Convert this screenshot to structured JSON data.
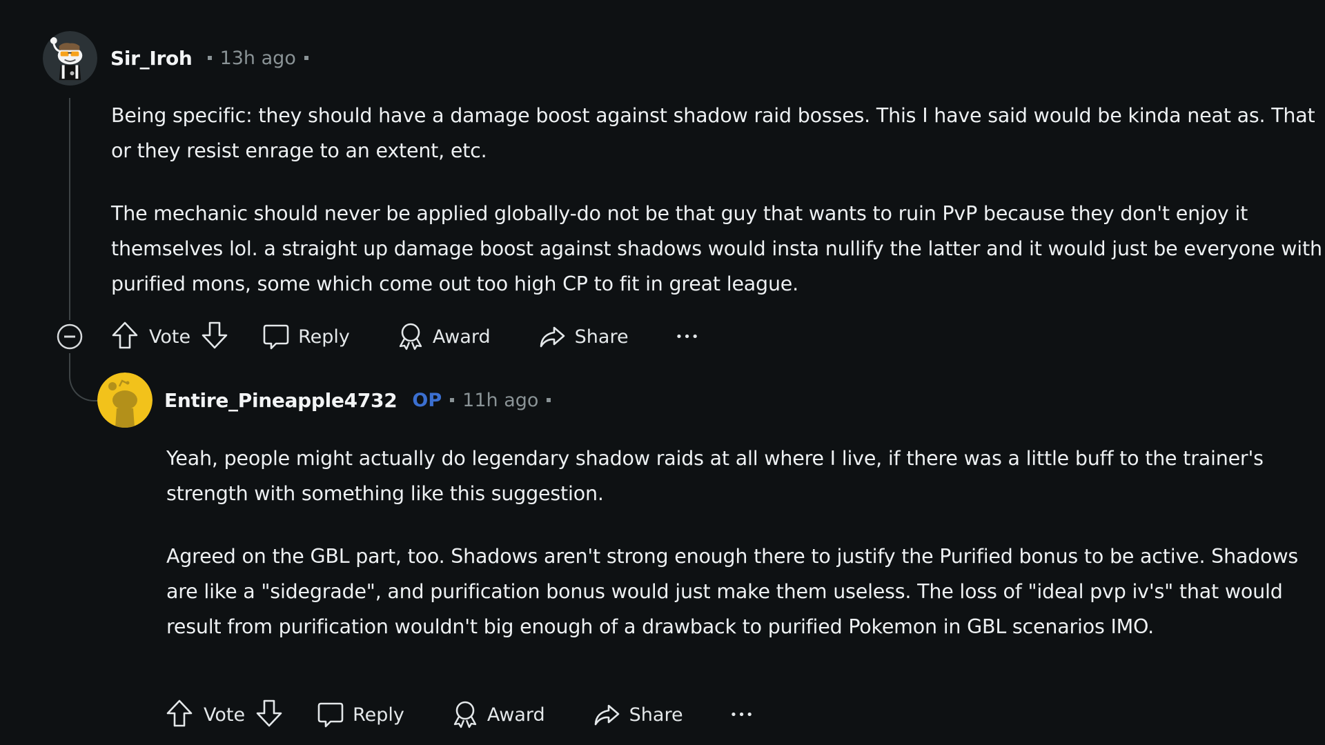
{
  "colors": {
    "background": "#0e1113",
    "text": "#eef1f3",
    "meta": "#8a9396",
    "op_badge": "#3b6fd0",
    "thread_line": "#3e4446",
    "reply_avatar": "#f2c21b"
  },
  "comments": [
    {
      "author": "Sir_Iroh",
      "avatar_icon": "snoo-avatar-sunglasses",
      "timestamp": "13h ago",
      "paragraphs": [
        "Being specific: they should have a damage boost against shadow raid bosses. This I have said would be kinda neat as. That or they resist enrage to an extent, etc.",
        "The mechanic should never be applied globally-do not be that guy that wants to ruin PvP because they don't enjoy it themselves lol. a straight up damage boost against shadows would insta nullify the latter and it would just be everyone with purified mons, some which come out too high CP to fit in great league."
      ],
      "actions": {
        "vote_label": "Vote",
        "reply_label": "Reply",
        "award_label": "Award",
        "share_label": "Share",
        "more_label": "•••"
      }
    },
    {
      "author": "Entire_Pineapple4732",
      "badge": "OP",
      "avatar_icon": "snoo-avatar-yellow",
      "timestamp": "11h ago",
      "paragraphs": [
        "Yeah, people might actually do legendary shadow raids at all where I live, if there was a little buff to the trainer's strength with something like this suggestion.",
        "Agreed on the GBL part, too. Shadows aren't strong enough there to justify the Purified bonus to be active. Shadows are like a \"sidegrade\", and purification bonus would just make them useless. The loss of \"ideal pvp iv's\" that would result from purification wouldn't big enough of a drawback to purified Pokemon in GBL scenarios IMO."
      ],
      "actions": {
        "vote_label": "Vote",
        "reply_label": "Reply",
        "award_label": "Award",
        "share_label": "Share",
        "more_label": "•••"
      }
    }
  ]
}
